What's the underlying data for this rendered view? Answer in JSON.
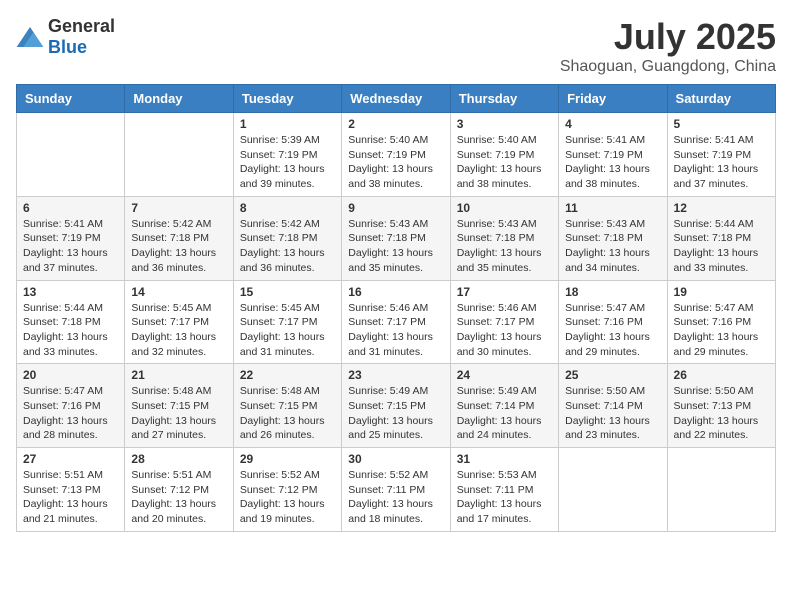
{
  "logo": {
    "general": "General",
    "blue": "Blue"
  },
  "title": "July 2025",
  "location": "Shaoguan, Guangdong, China",
  "days_of_week": [
    "Sunday",
    "Monday",
    "Tuesday",
    "Wednesday",
    "Thursday",
    "Friday",
    "Saturday"
  ],
  "weeks": [
    [
      {
        "day": "",
        "info": ""
      },
      {
        "day": "",
        "info": ""
      },
      {
        "day": "1",
        "info": "Sunrise: 5:39 AM\nSunset: 7:19 PM\nDaylight: 13 hours and 39 minutes."
      },
      {
        "day": "2",
        "info": "Sunrise: 5:40 AM\nSunset: 7:19 PM\nDaylight: 13 hours and 38 minutes."
      },
      {
        "day": "3",
        "info": "Sunrise: 5:40 AM\nSunset: 7:19 PM\nDaylight: 13 hours and 38 minutes."
      },
      {
        "day": "4",
        "info": "Sunrise: 5:41 AM\nSunset: 7:19 PM\nDaylight: 13 hours and 38 minutes."
      },
      {
        "day": "5",
        "info": "Sunrise: 5:41 AM\nSunset: 7:19 PM\nDaylight: 13 hours and 37 minutes."
      }
    ],
    [
      {
        "day": "6",
        "info": "Sunrise: 5:41 AM\nSunset: 7:19 PM\nDaylight: 13 hours and 37 minutes."
      },
      {
        "day": "7",
        "info": "Sunrise: 5:42 AM\nSunset: 7:18 PM\nDaylight: 13 hours and 36 minutes."
      },
      {
        "day": "8",
        "info": "Sunrise: 5:42 AM\nSunset: 7:18 PM\nDaylight: 13 hours and 36 minutes."
      },
      {
        "day": "9",
        "info": "Sunrise: 5:43 AM\nSunset: 7:18 PM\nDaylight: 13 hours and 35 minutes."
      },
      {
        "day": "10",
        "info": "Sunrise: 5:43 AM\nSunset: 7:18 PM\nDaylight: 13 hours and 35 minutes."
      },
      {
        "day": "11",
        "info": "Sunrise: 5:43 AM\nSunset: 7:18 PM\nDaylight: 13 hours and 34 minutes."
      },
      {
        "day": "12",
        "info": "Sunrise: 5:44 AM\nSunset: 7:18 PM\nDaylight: 13 hours and 33 minutes."
      }
    ],
    [
      {
        "day": "13",
        "info": "Sunrise: 5:44 AM\nSunset: 7:18 PM\nDaylight: 13 hours and 33 minutes."
      },
      {
        "day": "14",
        "info": "Sunrise: 5:45 AM\nSunset: 7:17 PM\nDaylight: 13 hours and 32 minutes."
      },
      {
        "day": "15",
        "info": "Sunrise: 5:45 AM\nSunset: 7:17 PM\nDaylight: 13 hours and 31 minutes."
      },
      {
        "day": "16",
        "info": "Sunrise: 5:46 AM\nSunset: 7:17 PM\nDaylight: 13 hours and 31 minutes."
      },
      {
        "day": "17",
        "info": "Sunrise: 5:46 AM\nSunset: 7:17 PM\nDaylight: 13 hours and 30 minutes."
      },
      {
        "day": "18",
        "info": "Sunrise: 5:47 AM\nSunset: 7:16 PM\nDaylight: 13 hours and 29 minutes."
      },
      {
        "day": "19",
        "info": "Sunrise: 5:47 AM\nSunset: 7:16 PM\nDaylight: 13 hours and 29 minutes."
      }
    ],
    [
      {
        "day": "20",
        "info": "Sunrise: 5:47 AM\nSunset: 7:16 PM\nDaylight: 13 hours and 28 minutes."
      },
      {
        "day": "21",
        "info": "Sunrise: 5:48 AM\nSunset: 7:15 PM\nDaylight: 13 hours and 27 minutes."
      },
      {
        "day": "22",
        "info": "Sunrise: 5:48 AM\nSunset: 7:15 PM\nDaylight: 13 hours and 26 minutes."
      },
      {
        "day": "23",
        "info": "Sunrise: 5:49 AM\nSunset: 7:15 PM\nDaylight: 13 hours and 25 minutes."
      },
      {
        "day": "24",
        "info": "Sunrise: 5:49 AM\nSunset: 7:14 PM\nDaylight: 13 hours and 24 minutes."
      },
      {
        "day": "25",
        "info": "Sunrise: 5:50 AM\nSunset: 7:14 PM\nDaylight: 13 hours and 23 minutes."
      },
      {
        "day": "26",
        "info": "Sunrise: 5:50 AM\nSunset: 7:13 PM\nDaylight: 13 hours and 22 minutes."
      }
    ],
    [
      {
        "day": "27",
        "info": "Sunrise: 5:51 AM\nSunset: 7:13 PM\nDaylight: 13 hours and 21 minutes."
      },
      {
        "day": "28",
        "info": "Sunrise: 5:51 AM\nSunset: 7:12 PM\nDaylight: 13 hours and 20 minutes."
      },
      {
        "day": "29",
        "info": "Sunrise: 5:52 AM\nSunset: 7:12 PM\nDaylight: 13 hours and 19 minutes."
      },
      {
        "day": "30",
        "info": "Sunrise: 5:52 AM\nSunset: 7:11 PM\nDaylight: 13 hours and 18 minutes."
      },
      {
        "day": "31",
        "info": "Sunrise: 5:53 AM\nSunset: 7:11 PM\nDaylight: 13 hours and 17 minutes."
      },
      {
        "day": "",
        "info": ""
      },
      {
        "day": "",
        "info": ""
      }
    ]
  ]
}
